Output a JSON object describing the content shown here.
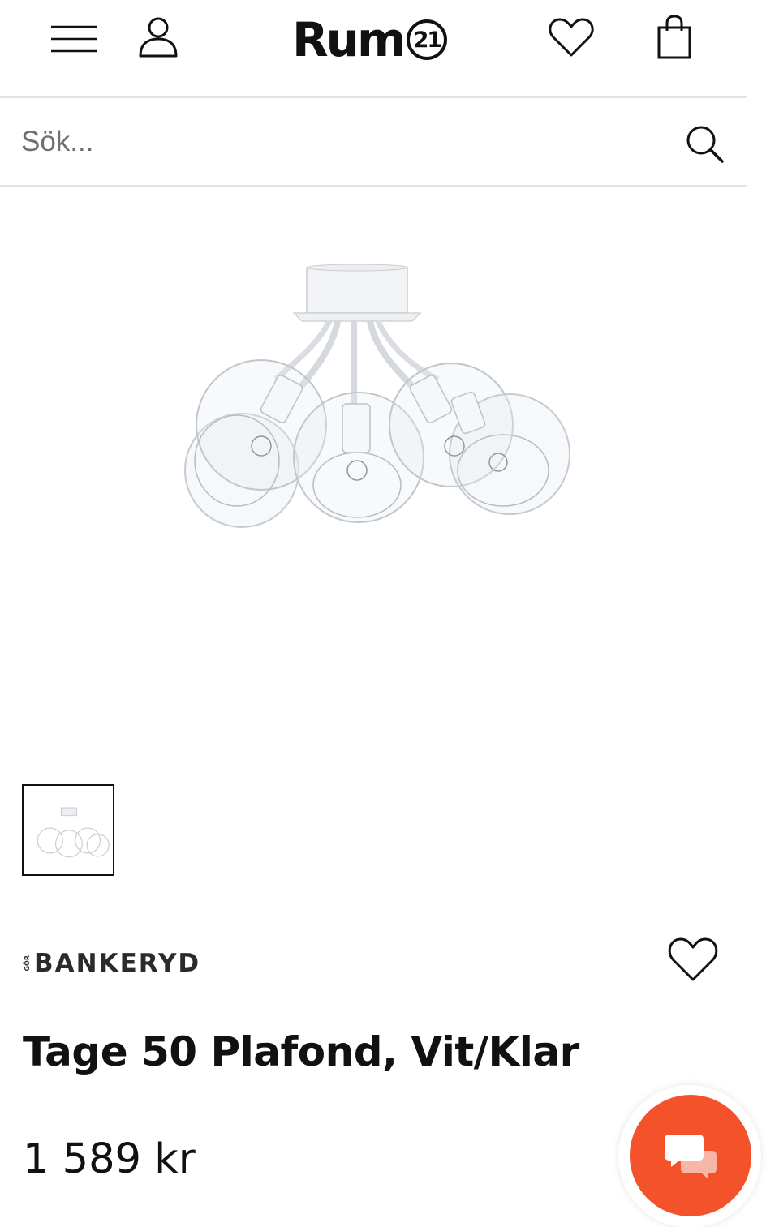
{
  "header": {
    "brand_name": "Rum",
    "brand_number": "21"
  },
  "search": {
    "placeholder": "Sök..."
  },
  "product": {
    "brand_prefix": "GÖR",
    "brand": "BANKERYD",
    "title": "Tage 50 Plafond, Vit/Klar",
    "price": "1 589 kr"
  },
  "colors": {
    "accent": "#f4522a",
    "text": "#111111",
    "divider": "#e3e3e3"
  },
  "icons": {
    "menu": "menu-icon",
    "account": "user-icon",
    "wishlist": "heart-icon",
    "cart": "bag-icon",
    "search": "search-icon",
    "product_wishlist": "heart-icon",
    "chat": "chat-icon"
  }
}
